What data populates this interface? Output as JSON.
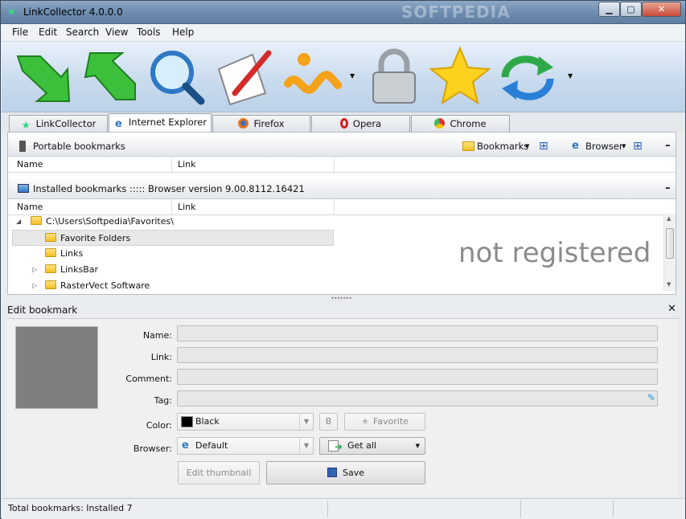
{
  "window": {
    "title": "LinkCollector 4.0.0.0",
    "watermark": "SOFTPEDIA",
    "minimize": "▁",
    "maximize": "▢",
    "close": "✕",
    "close_color": "#c94a3a"
  },
  "menu": [
    "File",
    "Edit",
    "Search",
    "View",
    "Tools",
    "Help"
  ],
  "toolbar": {
    "icons": [
      "import-arrow-icon",
      "export-arrow-icon",
      "search-magnifier-icon",
      "edit-pencil-icon",
      "info-icon",
      "lock-icon",
      "favorite-star-icon",
      "sync-icon"
    ]
  },
  "tabs": [
    {
      "label": "LinkCollector"
    },
    {
      "label": "Internet Explorer"
    },
    {
      "label": "Firefox"
    },
    {
      "label": "Opera"
    },
    {
      "label": "Chrome"
    }
  ],
  "portable": {
    "title": "Portable bookmarks",
    "bookmarks_btn": "Bookmarks",
    "browser_btn": "Browser",
    "collapse": "–"
  },
  "columns": {
    "name": "Name",
    "link": "Link"
  },
  "installed": {
    "title": "Installed bookmarks ::::: Browser version 9.00.8112.16421",
    "collapse": "–"
  },
  "tree": [
    {
      "label": "C:\\Users\\Softpedia\\Favorites\\",
      "expander": "◢"
    },
    {
      "label": "Favorite Folders",
      "expander": ""
    },
    {
      "label": "Links",
      "expander": ""
    },
    {
      "label": "LinksBar",
      "expander": "▷"
    },
    {
      "label": "RasterVect Software",
      "expander": "▷"
    }
  ],
  "watermark_text": "not registered",
  "splitter": "•••••••",
  "edit": {
    "title": "Edit bookmark",
    "close": "✕",
    "labels": {
      "name": "Name:",
      "link": "Link:",
      "comment": "Comment:",
      "tag": "Tag:",
      "color": "Color:",
      "browser": "Browser:"
    },
    "color_value": "Black",
    "bold_btn": "B",
    "favorite_btn": "Favorite",
    "browser_value": "Default",
    "getall_btn": "Get all",
    "thumbnail_btn": "Edit thumbnail",
    "save_btn": "Save"
  },
  "status": {
    "text": "Total bookmarks:  Installed 7"
  },
  "colors": {
    "accent": "#2f78c4",
    "thumb": "#7f7f7f",
    "black_swatch": "#000000"
  }
}
